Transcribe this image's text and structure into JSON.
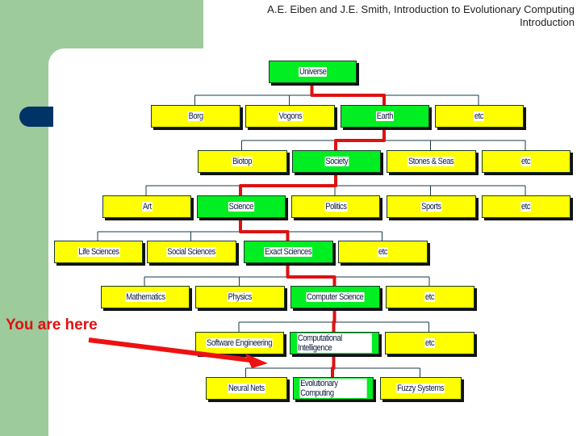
{
  "header": {
    "line1": "A.E. Eiben and J.E. Smith, Introduction to Evolutionary Computing",
    "line2": "Introduction"
  },
  "annotation": {
    "label": "You are here",
    "color": "#dd1111"
  },
  "colors": {
    "path": "#dd1111",
    "highlight": "#00ee22",
    "normal": "#ffff00",
    "background_band": "#9dcb9b",
    "tab": "#003366"
  },
  "tree": {
    "rows": [
      [
        {
          "label": "Universe",
          "on_path": true
        }
      ],
      [
        {
          "label": "Borg",
          "on_path": false
        },
        {
          "label": "Vogons",
          "on_path": false
        },
        {
          "label": "Earth",
          "on_path": true
        },
        {
          "label": "etc",
          "on_path": false
        }
      ],
      [
        {
          "label": "Biotop",
          "on_path": false
        },
        {
          "label": "Society",
          "on_path": true
        },
        {
          "label": "Stones & Seas",
          "on_path": false
        },
        {
          "label": "etc",
          "on_path": false
        }
      ],
      [
        {
          "label": "Art",
          "on_path": false
        },
        {
          "label": "Science",
          "on_path": true
        },
        {
          "label": "Politics",
          "on_path": false
        },
        {
          "label": "Sports",
          "on_path": false
        },
        {
          "label": "etc",
          "on_path": false
        }
      ],
      [
        {
          "label": "Life Sciences",
          "on_path": false
        },
        {
          "label": "Social Sciences",
          "on_path": false
        },
        {
          "label": "Exact Sciences",
          "on_path": true
        },
        {
          "label": "etc",
          "on_path": false
        }
      ],
      [
        {
          "label": "Mathematics",
          "on_path": false
        },
        {
          "label": "Physics",
          "on_path": false
        },
        {
          "label": "Computer Science",
          "on_path": true
        },
        {
          "label": "etc",
          "on_path": false
        }
      ],
      [
        {
          "label": "Software Engineering",
          "on_path": false
        },
        {
          "label": "Computational Intelligence",
          "on_path": true
        },
        {
          "label": "etc",
          "on_path": false
        }
      ],
      [
        {
          "label": "Neural Nets",
          "on_path": false
        },
        {
          "label": "Evolutionary Computing",
          "on_path": true
        },
        {
          "label": "Fuzzy Systems",
          "on_path": false
        }
      ]
    ]
  }
}
